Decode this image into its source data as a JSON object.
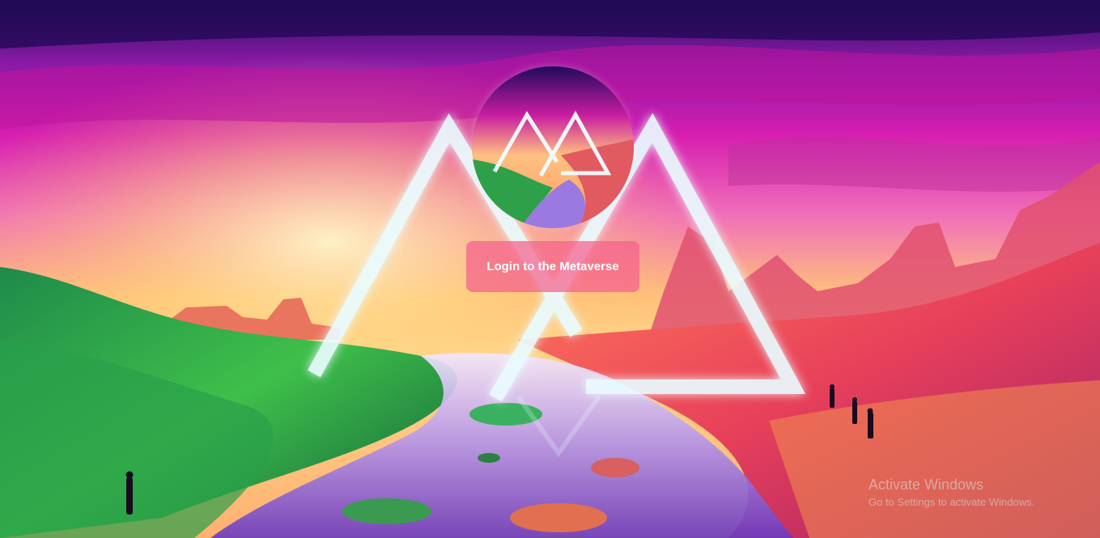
{
  "hero": {
    "background": "surreal neon desert landscape with glowing triangle portals",
    "colors": {
      "sky_top": "#2a0a5e",
      "sky_magenta": "#d41ca8",
      "sun_glow": "#ffe08a",
      "triangle_glow": "#e8fbff",
      "button_bg": "#f4608c"
    }
  },
  "logo": {
    "icon": "metaverse-logo-icon"
  },
  "login": {
    "label": "Login to the Metaverse"
  },
  "os_watermark": {
    "title": "Activate Windows",
    "subtitle": "Go to Settings to activate Windows."
  }
}
